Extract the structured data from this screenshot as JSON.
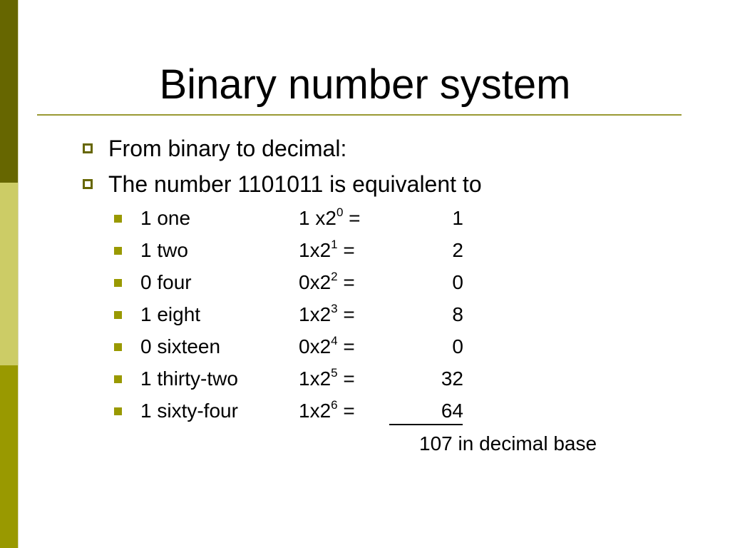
{
  "slide": {
    "title": "Binary number system",
    "bullets": [
      "From binary to decimal:",
      "The number 1101011 is equivalent to"
    ],
    "rows": [
      {
        "label": "1 one",
        "expr_base": "1 x2",
        "exponent": "0",
        "expr_tail": " =",
        "value": "1"
      },
      {
        "label": "1 two",
        "expr_base": "1x2",
        "exponent": "1",
        "expr_tail": " =",
        "value": "2"
      },
      {
        "label": "0 four",
        "expr_base": "0x2",
        "exponent": "2",
        "expr_tail": " =",
        "value": "0"
      },
      {
        "label": "1 eight",
        "expr_base": "1x2",
        "exponent": "3",
        "expr_tail": " =",
        "value": "8"
      },
      {
        "label": "0 sixteen",
        "expr_base": "0x2",
        "exponent": "4",
        "expr_tail": " =",
        "value": "0"
      },
      {
        "label": "1 thirty-two",
        "expr_base": "1x2",
        "exponent": "5",
        "expr_tail": " =",
        "value": "32"
      },
      {
        "label": "1 sixty-four",
        "expr_base": "1x2",
        "exponent": "6",
        "expr_tail": " =",
        "value": "64"
      }
    ],
    "total": "107 in decimal base"
  },
  "colors": {
    "sidebar_dark": "#666600",
    "sidebar_light": "#cccc66",
    "sidebar_mid": "#999900",
    "title_rule": "#999933"
  }
}
